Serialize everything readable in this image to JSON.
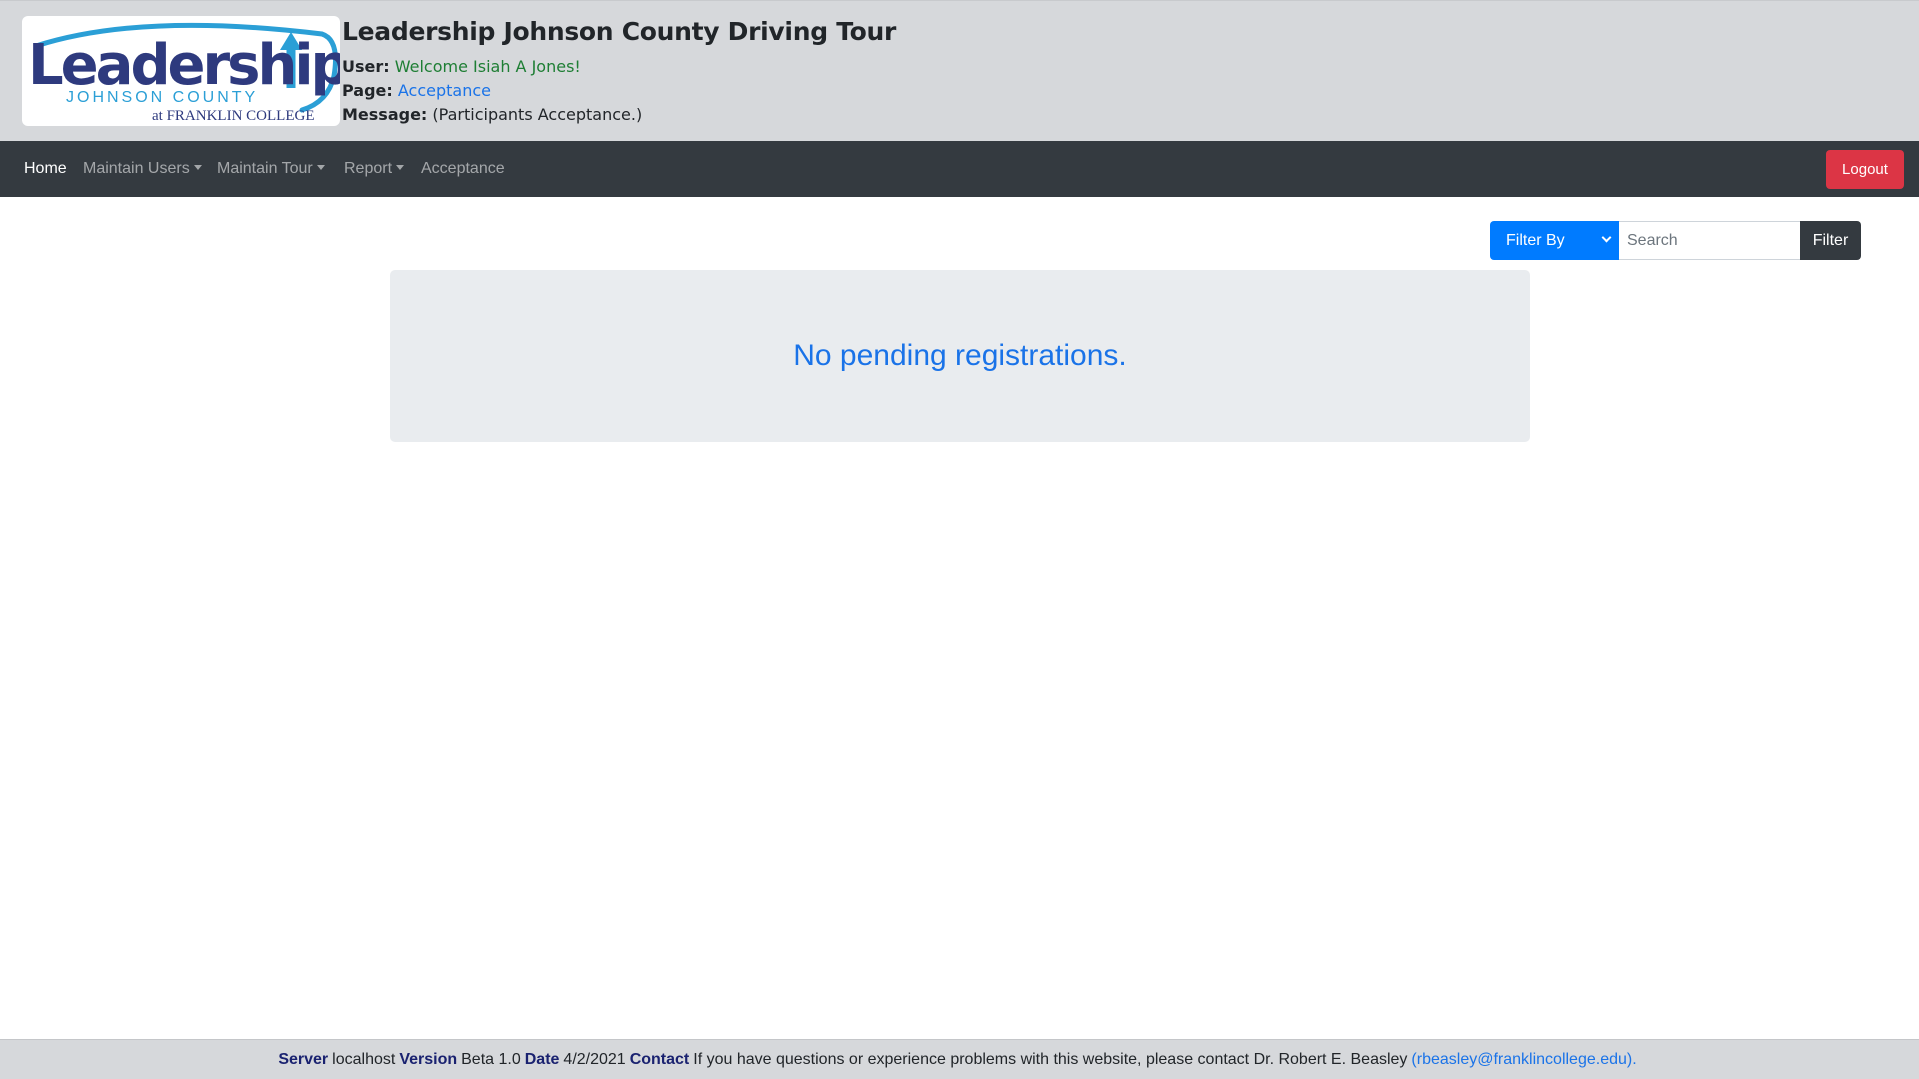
{
  "header": {
    "logo": {
      "word": "Leadership",
      "sub": "JOHNSON COUNTY",
      "tag": "at FRANKLIN COLLEGE"
    },
    "title": "Leadership Johnson County Driving Tour",
    "user_label": "User:",
    "user_value": "Welcome Isiah A Jones!",
    "page_label": "Page:",
    "page_value": "Acceptance",
    "message_label": "Message:",
    "message_value": "(Participants Acceptance.)"
  },
  "nav": {
    "home": "Home",
    "maintain_users": "Maintain Users",
    "maintain_tour": "Maintain Tour",
    "report": "Report",
    "acceptance": "Acceptance",
    "logout": "Logout"
  },
  "filter": {
    "select_label": "Filter By",
    "search_placeholder": "Search",
    "button_label": "Filter"
  },
  "main": {
    "message": "No pending registrations."
  },
  "footer": {
    "server_label": "Server",
    "server_value": "localhost",
    "version_label": "Version",
    "version_value": "Beta 1.0",
    "date_label": "Date",
    "date_value": "4/2/2021",
    "contact_label": "Contact",
    "contact_text": "If you have questions or experience problems with this website, please contact Dr. Robert E. Beasley",
    "contact_email": "(rbeasley@franklincollege.edu)."
  },
  "colors": {
    "nav_bg": "#343a40",
    "header_bg": "#d6d8db",
    "primary": "#007bff",
    "danger": "#dc3545",
    "logo_navy": "#2e3a7e",
    "logo_teal": "#2b9fd6"
  }
}
